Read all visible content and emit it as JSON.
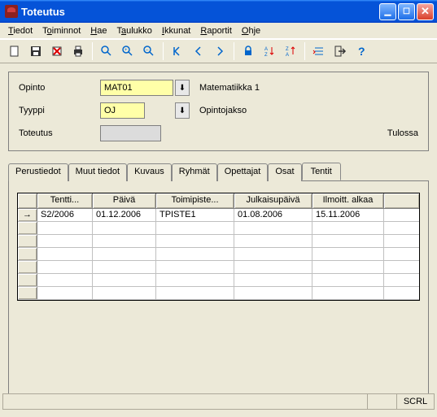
{
  "window": {
    "title": "Toteutus"
  },
  "menu": {
    "items": [
      {
        "label": "Tiedot",
        "key": "T"
      },
      {
        "label": "Toiminnot",
        "key": "o"
      },
      {
        "label": "Hae",
        "key": "H"
      },
      {
        "label": "Taulukko",
        "key": "a"
      },
      {
        "label": "Ikkunat",
        "key": "I"
      },
      {
        "label": "Raportit",
        "key": "R"
      },
      {
        "label": "Ohje",
        "key": "O"
      }
    ]
  },
  "form": {
    "opinto": {
      "label": "Opinto",
      "value": "MAT01",
      "desc": "Matematiikka 1"
    },
    "tyyppi": {
      "label": "Tyyppi",
      "value": "OJ",
      "desc": "Opintojakso"
    },
    "toteutus": {
      "label": "Toteutus",
      "value": "",
      "status": "Tulossa"
    }
  },
  "tabs": {
    "items": [
      "Perustiedot",
      "Muut tiedot",
      "Kuvaus",
      "Ryhmät",
      "Opettajat",
      "Osat",
      "Tentit"
    ],
    "active": 6
  },
  "grid": {
    "headers": [
      "Tentti...",
      "Päivä",
      "Toimipiste...",
      "Julkaisupäivä",
      "Ilmoitt. alkaa",
      ""
    ],
    "rows": [
      {
        "c1": "S2/2006",
        "c2": "01.12.2006",
        "c3": "TPISTE1",
        "c4": "01.08.2006",
        "c5": "15.11.2006",
        "c6": ""
      }
    ],
    "emptyRows": 6
  },
  "status": {
    "scrl": "SCRL"
  }
}
